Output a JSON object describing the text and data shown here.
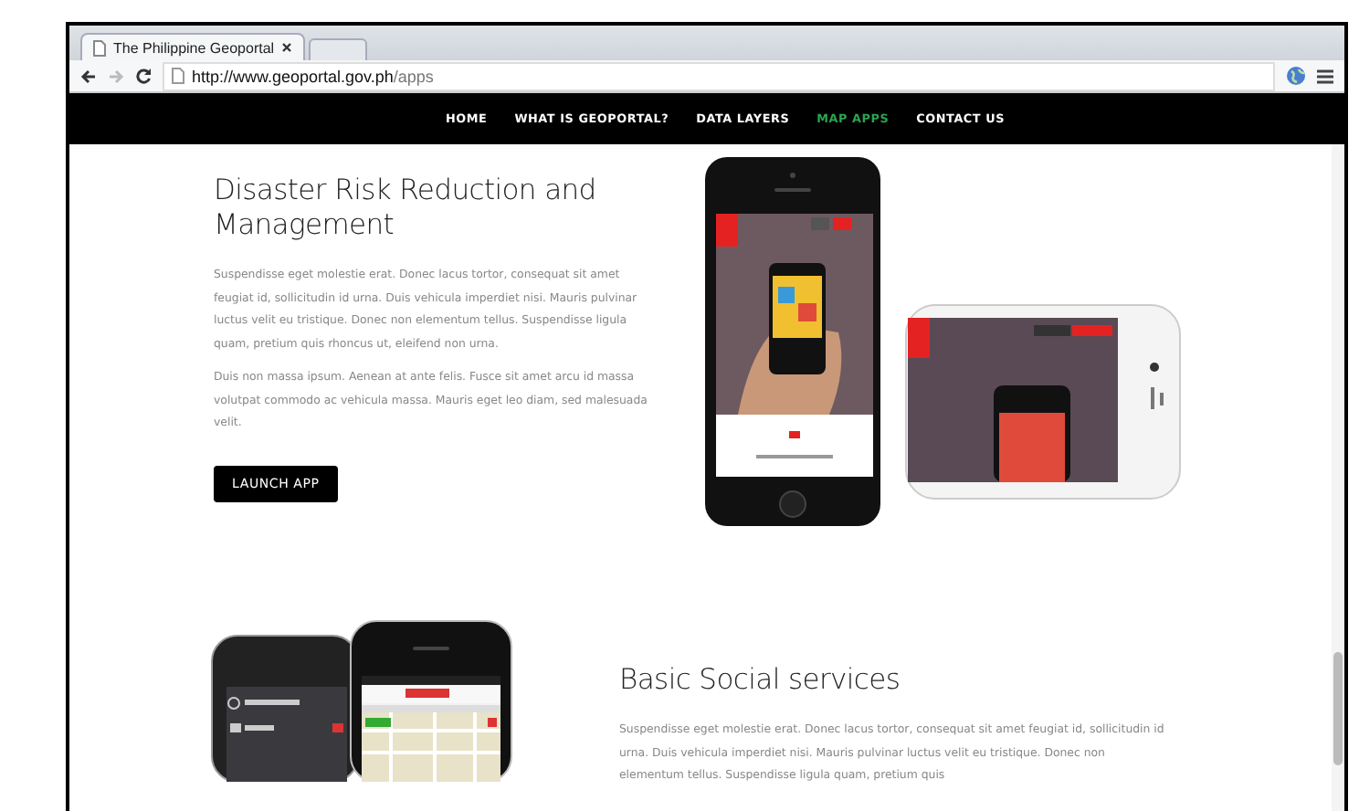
{
  "browser": {
    "tab": {
      "title": "The Philippine Geoportal"
    },
    "url": {
      "host": "http://www.geoportal.gov.ph",
      "path": "/apps"
    }
  },
  "nav": [
    {
      "label": "HOME",
      "selected": false
    },
    {
      "label": "WHAT IS GEOPORTAL?",
      "selected": false
    },
    {
      "label": "DATA LAYERS",
      "selected": false
    },
    {
      "label": "MAP APPS",
      "selected": true
    },
    {
      "label": "CONTACT US",
      "selected": false
    }
  ],
  "sections": [
    {
      "kind": "image_right",
      "heading": "Disaster Risk Reduction and Management",
      "paragraphs": [
        "Suspendisse eget molestie erat. Donec lacus tortor, consequat sit amet feugiat id, sollicitudin id urna. Duis vehicula imperdiet nisi. Mauris pulvinar luctus velit eu tristique. Donec non elementum tellus. Suspendisse ligula quam, pretium quis rhoncus ut, eleifend non urna.",
        "Duis non massa ipsum. Aenean at ante felis. Fusce sit amet arcu id massa volutpat commodo ac vehicula massa. Mauris eget leo diam, sed malesuada velit."
      ],
      "button": "LAUNCH APP"
    },
    {
      "kind": "image_left",
      "heading": "Basic Social services",
      "paragraphs": [
        "Suspendisse eget molestie erat. Donec lacus tortor, consequat sit amet feugiat id, sollicitudin id urna. Duis vehicula imperdiet nisi. Mauris pulvinar luctus velit eu tristique. Donec non elementum tellus. Suspendisse ligula quam, pretium quis"
      ]
    }
  ]
}
